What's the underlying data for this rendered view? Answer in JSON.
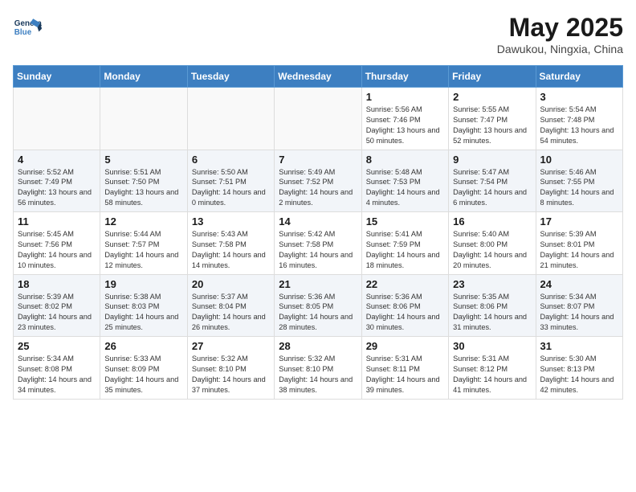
{
  "header": {
    "logo_line1": "General",
    "logo_line2": "Blue",
    "month_year": "May 2025",
    "location": "Dawukou, Ningxia, China"
  },
  "days_of_week": [
    "Sunday",
    "Monday",
    "Tuesday",
    "Wednesday",
    "Thursday",
    "Friday",
    "Saturday"
  ],
  "weeks": [
    [
      {
        "day": "",
        "content": ""
      },
      {
        "day": "",
        "content": ""
      },
      {
        "day": "",
        "content": ""
      },
      {
        "day": "",
        "content": ""
      },
      {
        "day": "1",
        "content": "Sunrise: 5:56 AM\nSunset: 7:46 PM\nDaylight: 13 hours\nand 50 minutes."
      },
      {
        "day": "2",
        "content": "Sunrise: 5:55 AM\nSunset: 7:47 PM\nDaylight: 13 hours\nand 52 minutes."
      },
      {
        "day": "3",
        "content": "Sunrise: 5:54 AM\nSunset: 7:48 PM\nDaylight: 13 hours\nand 54 minutes."
      }
    ],
    [
      {
        "day": "4",
        "content": "Sunrise: 5:52 AM\nSunset: 7:49 PM\nDaylight: 13 hours\nand 56 minutes."
      },
      {
        "day": "5",
        "content": "Sunrise: 5:51 AM\nSunset: 7:50 PM\nDaylight: 13 hours\nand 58 minutes."
      },
      {
        "day": "6",
        "content": "Sunrise: 5:50 AM\nSunset: 7:51 PM\nDaylight: 14 hours\nand 0 minutes."
      },
      {
        "day": "7",
        "content": "Sunrise: 5:49 AM\nSunset: 7:52 PM\nDaylight: 14 hours\nand 2 minutes."
      },
      {
        "day": "8",
        "content": "Sunrise: 5:48 AM\nSunset: 7:53 PM\nDaylight: 14 hours\nand 4 minutes."
      },
      {
        "day": "9",
        "content": "Sunrise: 5:47 AM\nSunset: 7:54 PM\nDaylight: 14 hours\nand 6 minutes."
      },
      {
        "day": "10",
        "content": "Sunrise: 5:46 AM\nSunset: 7:55 PM\nDaylight: 14 hours\nand 8 minutes."
      }
    ],
    [
      {
        "day": "11",
        "content": "Sunrise: 5:45 AM\nSunset: 7:56 PM\nDaylight: 14 hours\nand 10 minutes."
      },
      {
        "day": "12",
        "content": "Sunrise: 5:44 AM\nSunset: 7:57 PM\nDaylight: 14 hours\nand 12 minutes."
      },
      {
        "day": "13",
        "content": "Sunrise: 5:43 AM\nSunset: 7:58 PM\nDaylight: 14 hours\nand 14 minutes."
      },
      {
        "day": "14",
        "content": "Sunrise: 5:42 AM\nSunset: 7:58 PM\nDaylight: 14 hours\nand 16 minutes."
      },
      {
        "day": "15",
        "content": "Sunrise: 5:41 AM\nSunset: 7:59 PM\nDaylight: 14 hours\nand 18 minutes."
      },
      {
        "day": "16",
        "content": "Sunrise: 5:40 AM\nSunset: 8:00 PM\nDaylight: 14 hours\nand 20 minutes."
      },
      {
        "day": "17",
        "content": "Sunrise: 5:39 AM\nSunset: 8:01 PM\nDaylight: 14 hours\nand 21 minutes."
      }
    ],
    [
      {
        "day": "18",
        "content": "Sunrise: 5:39 AM\nSunset: 8:02 PM\nDaylight: 14 hours\nand 23 minutes."
      },
      {
        "day": "19",
        "content": "Sunrise: 5:38 AM\nSunset: 8:03 PM\nDaylight: 14 hours\nand 25 minutes."
      },
      {
        "day": "20",
        "content": "Sunrise: 5:37 AM\nSunset: 8:04 PM\nDaylight: 14 hours\nand 26 minutes."
      },
      {
        "day": "21",
        "content": "Sunrise: 5:36 AM\nSunset: 8:05 PM\nDaylight: 14 hours\nand 28 minutes."
      },
      {
        "day": "22",
        "content": "Sunrise: 5:36 AM\nSunset: 8:06 PM\nDaylight: 14 hours\nand 30 minutes."
      },
      {
        "day": "23",
        "content": "Sunrise: 5:35 AM\nSunset: 8:06 PM\nDaylight: 14 hours\nand 31 minutes."
      },
      {
        "day": "24",
        "content": "Sunrise: 5:34 AM\nSunset: 8:07 PM\nDaylight: 14 hours\nand 33 minutes."
      }
    ],
    [
      {
        "day": "25",
        "content": "Sunrise: 5:34 AM\nSunset: 8:08 PM\nDaylight: 14 hours\nand 34 minutes."
      },
      {
        "day": "26",
        "content": "Sunrise: 5:33 AM\nSunset: 8:09 PM\nDaylight: 14 hours\nand 35 minutes."
      },
      {
        "day": "27",
        "content": "Sunrise: 5:32 AM\nSunset: 8:10 PM\nDaylight: 14 hours\nand 37 minutes."
      },
      {
        "day": "28",
        "content": "Sunrise: 5:32 AM\nSunset: 8:10 PM\nDaylight: 14 hours\nand 38 minutes."
      },
      {
        "day": "29",
        "content": "Sunrise: 5:31 AM\nSunset: 8:11 PM\nDaylight: 14 hours\nand 39 minutes."
      },
      {
        "day": "30",
        "content": "Sunrise: 5:31 AM\nSunset: 8:12 PM\nDaylight: 14 hours\nand 41 minutes."
      },
      {
        "day": "31",
        "content": "Sunrise: 5:30 AM\nSunset: 8:13 PM\nDaylight: 14 hours\nand 42 minutes."
      }
    ]
  ]
}
